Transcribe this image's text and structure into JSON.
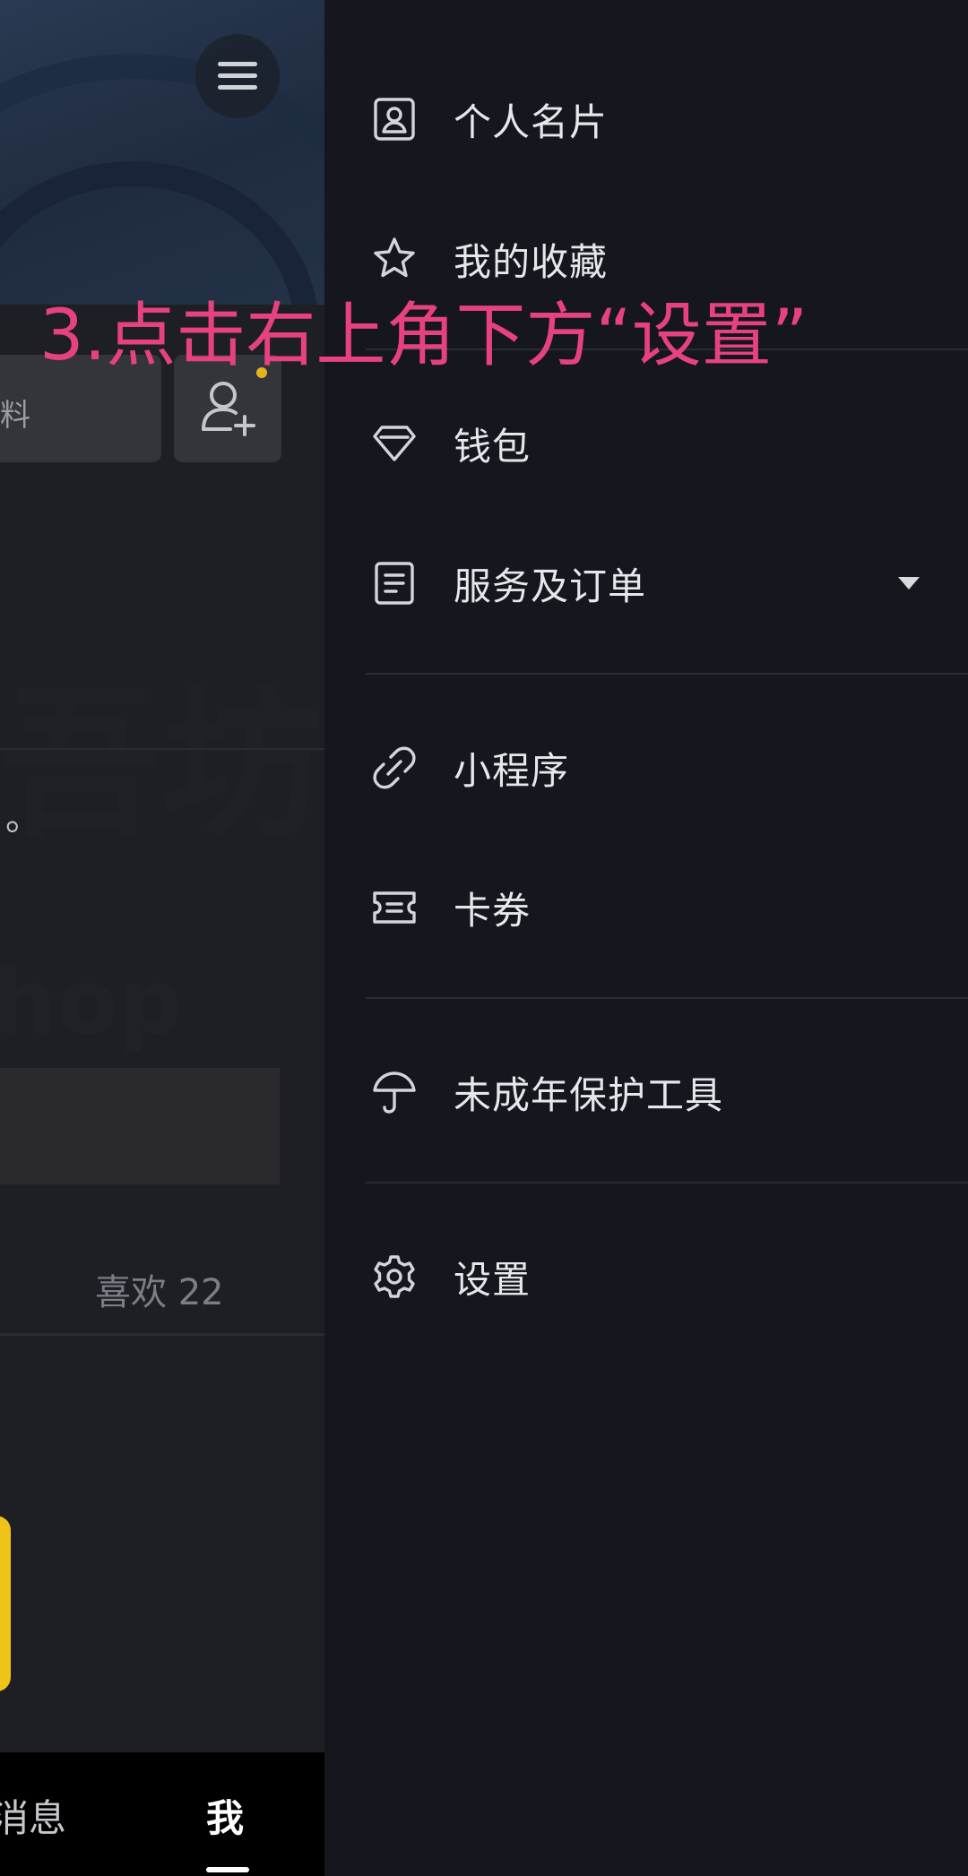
{
  "caption": "3.点击右上角下方“设置”",
  "profile": {
    "edit_label_fragment": "料",
    "period_mark": "。",
    "likes": "喜欢 22",
    "nav_messages": "消息",
    "nav_me": "我"
  },
  "drawer": {
    "items": [
      {
        "label": "个人名片",
        "icon": "profile-card-icon"
      },
      {
        "label": "我的收藏",
        "icon": "star-icon"
      },
      {
        "label": "钱包",
        "icon": "diamond-icon"
      },
      {
        "label": "服务及订单",
        "icon": "document-icon"
      },
      {
        "label": "小程序",
        "icon": "link-icon"
      },
      {
        "label": "卡券",
        "icon": "ticket-icon"
      },
      {
        "label": "未成年保护工具",
        "icon": "umbrella-icon"
      },
      {
        "label": "设置",
        "icon": "gear-icon"
      }
    ]
  },
  "colors": {
    "caption": "#e5427f",
    "drawer_bg": "#15161e",
    "accent_yellow": "#f0c417"
  }
}
